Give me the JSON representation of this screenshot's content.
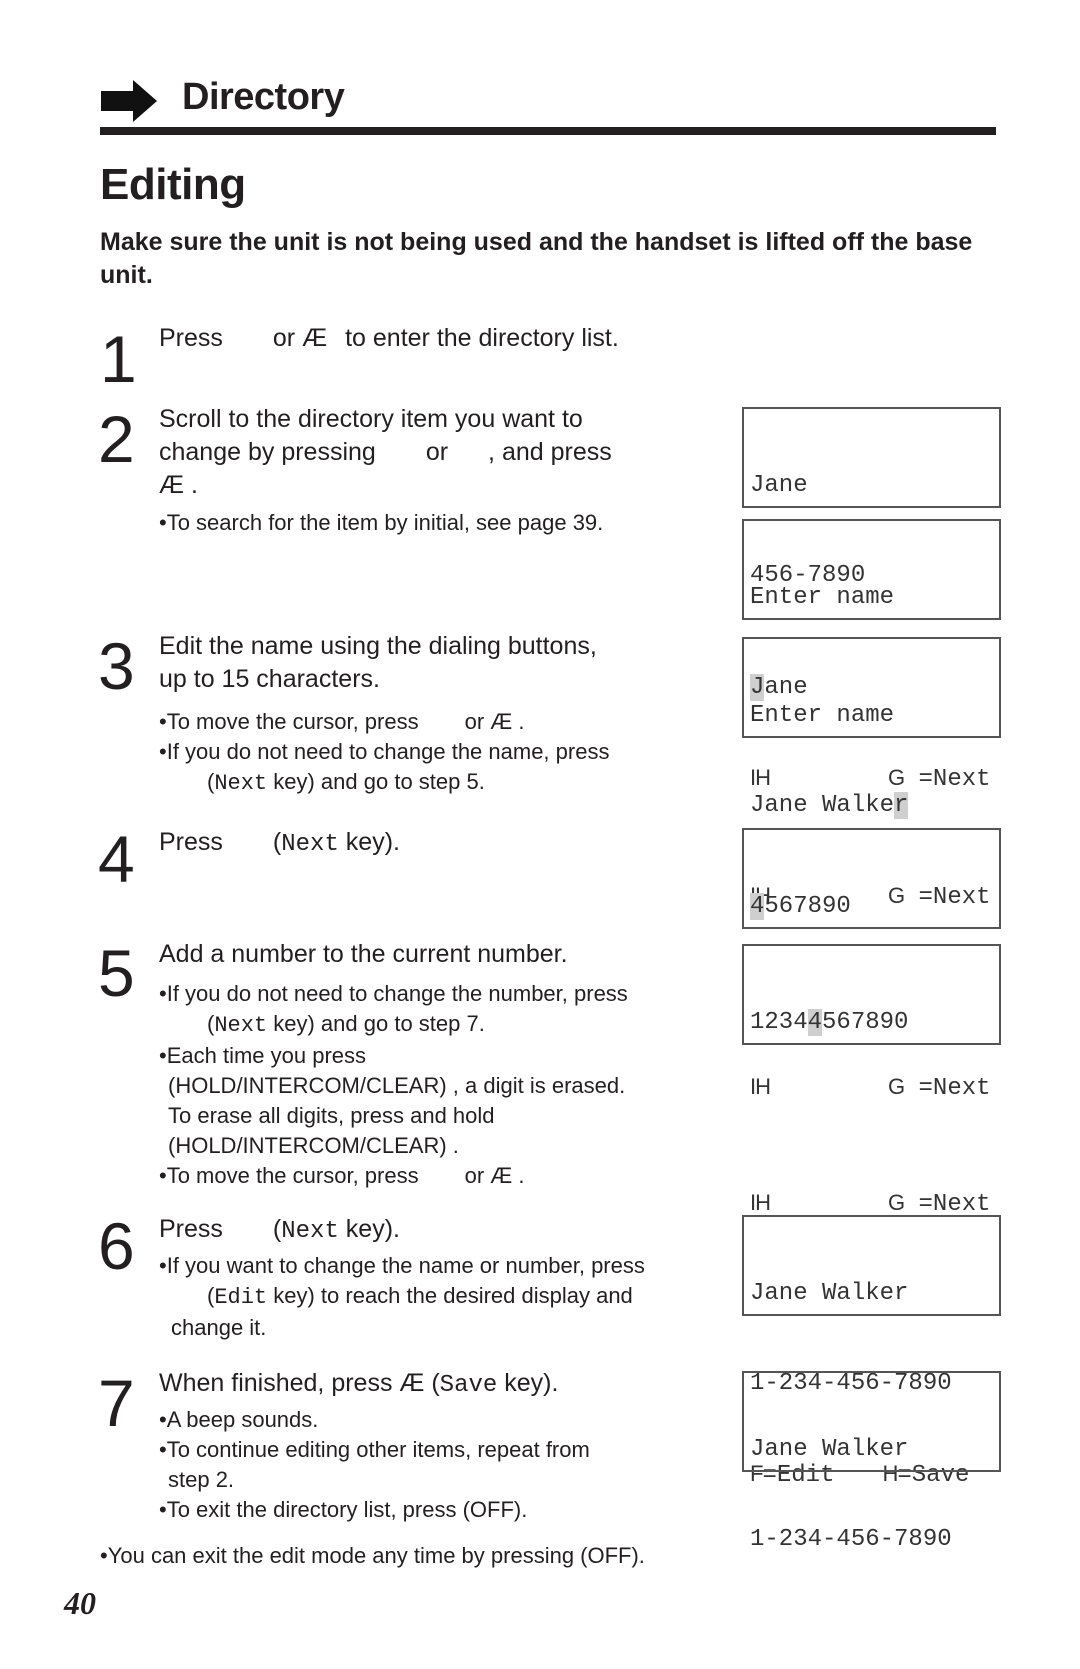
{
  "header": {
    "section_title": "Directory",
    "page_title": "Editing",
    "intro": "Make sure the unit is not being used and the handset is lifted off the base unit."
  },
  "steps": [
    {
      "number": "1",
      "lines": [
        "Press",
        "or Æ",
        "to enter the directory list."
      ]
    },
    {
      "number": "2",
      "lines": [
        "Scroll to the directory item you want to",
        "change by pressing",
        "or",
        ", and press",
        "Æ ."
      ],
      "notes": [
        "•To search for the item by initial, see page 39."
      ]
    },
    {
      "number": "3",
      "lines": [
        "Edit the name using the dialing buttons,",
        "up to 15 characters."
      ],
      "notes": [
        "•To move the cursor, press",
        "or Æ .",
        "•If you do not need to change the name, press",
        "(",
        "Next",
        " key) and go to step 5."
      ]
    },
    {
      "number": "4",
      "lines": [
        "Press",
        "(",
        "Next",
        " key)."
      ]
    },
    {
      "number": "5",
      "lines": [
        "Add a number to the current number."
      ],
      "notes": [
        "•If you do not need to change the number, press",
        "(",
        "Next",
        " key) and go to step 7.",
        "•Each time you press",
        "(HOLD/INTERCOM/CLEAR) , a digit is erased.",
        "To erase all digits, press and hold",
        "(HOLD/INTERCOM/CLEAR) .",
        "•To move the cursor, press",
        "or Æ ."
      ]
    },
    {
      "number": "6",
      "lines": [
        "Press",
        "(",
        "Next",
        " key)."
      ],
      "notes": [
        "•If you want to change the name or number, press",
        "(",
        "Edit",
        " key) to reach the desired display and",
        "change it."
      ]
    },
    {
      "number": "7",
      "lines": [
        "When finished, press Æ  (",
        "Save",
        " key)."
      ],
      "notes": [
        "•A beep sounds.",
        "•To continue editing other items, repeat from",
        "step 2.",
        "•To exit the directory list, press (OFF)."
      ]
    }
  ],
  "footer_note": "•You can exit the edit mode any time by pressing (OFF).",
  "page_number": "40",
  "displays": [
    {
      "line1": "Jane",
      "line2": "456-7890",
      "line3": ""
    },
    {
      "line1": "Enter name",
      "line2_cursor": "J",
      "line2_rest": "ane",
      "left_key": "IH",
      "right_key": "G",
      "right_label": " =Next"
    },
    {
      "line1": "Enter name",
      "line2_rest": "Jane Walke",
      "line2_cursor": "r",
      "left_key": "IH",
      "right_key": "G",
      "right_label": " =Next"
    },
    {
      "line1_cursor": "4",
      "line1_rest": "567890",
      "left_key": "IH",
      "right_key": "G",
      "right_label": " =Next"
    },
    {
      "line1_pre": "1234",
      "line1_cursor": "4",
      "line1_rest": "567890",
      "left_key": "IH",
      "right_key": "G",
      "right_label": " =Next"
    },
    {
      "line1": "Jane Walker",
      "line2": "1-234-456-7890",
      "left_key": "F",
      "left_label": "=Edit",
      "right_key": "H",
      "right_label": "=Save"
    },
    {
      "line1": "Jane Walker",
      "line2": "1-234-456-7890"
    }
  ]
}
